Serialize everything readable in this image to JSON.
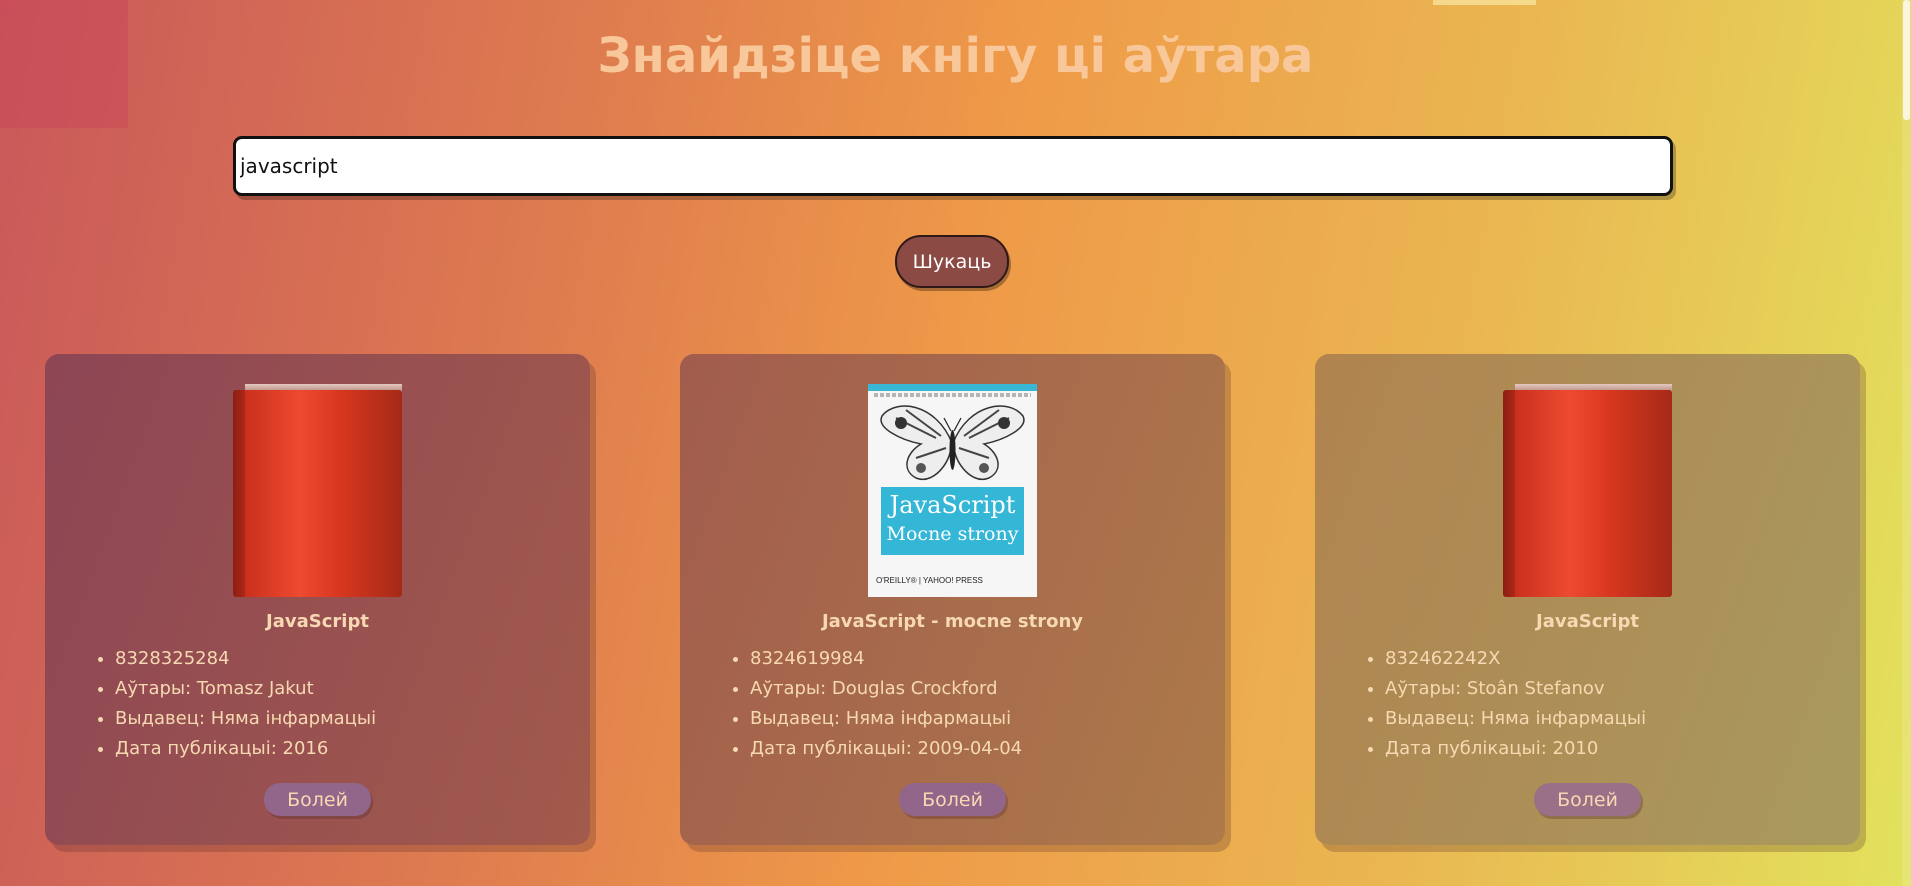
{
  "page": {
    "title": "Знайдзіце кнігу ці аўтара"
  },
  "search": {
    "value": "javascript",
    "button_label": "Шукаць"
  },
  "books": [
    {
      "title": "JavaScript",
      "cover": "red-book-icon",
      "isbn": "8328325284",
      "authors": "Аўтары: Tomasz Jakut",
      "publisher": "Выдавец: Няма інфармацыі",
      "date": "Дата публікацыі: 2016",
      "more_label": "Болей"
    },
    {
      "title": "JavaScript - mocne strony",
      "cover": "butterfly-cover",
      "cover_text": {
        "line1": "JavaScript",
        "line2": "Mocne strony",
        "publisher": "O'REILLY® | YAHOO! PRESS"
      },
      "isbn": "8324619984",
      "authors": "Аўтары: Douglas Crockford",
      "publisher": "Выдавец: Няма інфармацыі",
      "date": "Дата публікацыі: 2009-04-04",
      "more_label": "Болей"
    },
    {
      "title": "JavaScript",
      "cover": "red-book-icon",
      "isbn": "832462242X",
      "authors": "Аўтары: Stoân Stefanov",
      "publisher": "Выдавец: Няма інфармацыі",
      "date": "Дата публікацыі: 2010",
      "more_label": "Болей"
    }
  ],
  "colors": {
    "title": "#f8c89a",
    "card_text": "#f6d9b2",
    "search_button": "#8c4a45",
    "more_button": "#91668a"
  }
}
